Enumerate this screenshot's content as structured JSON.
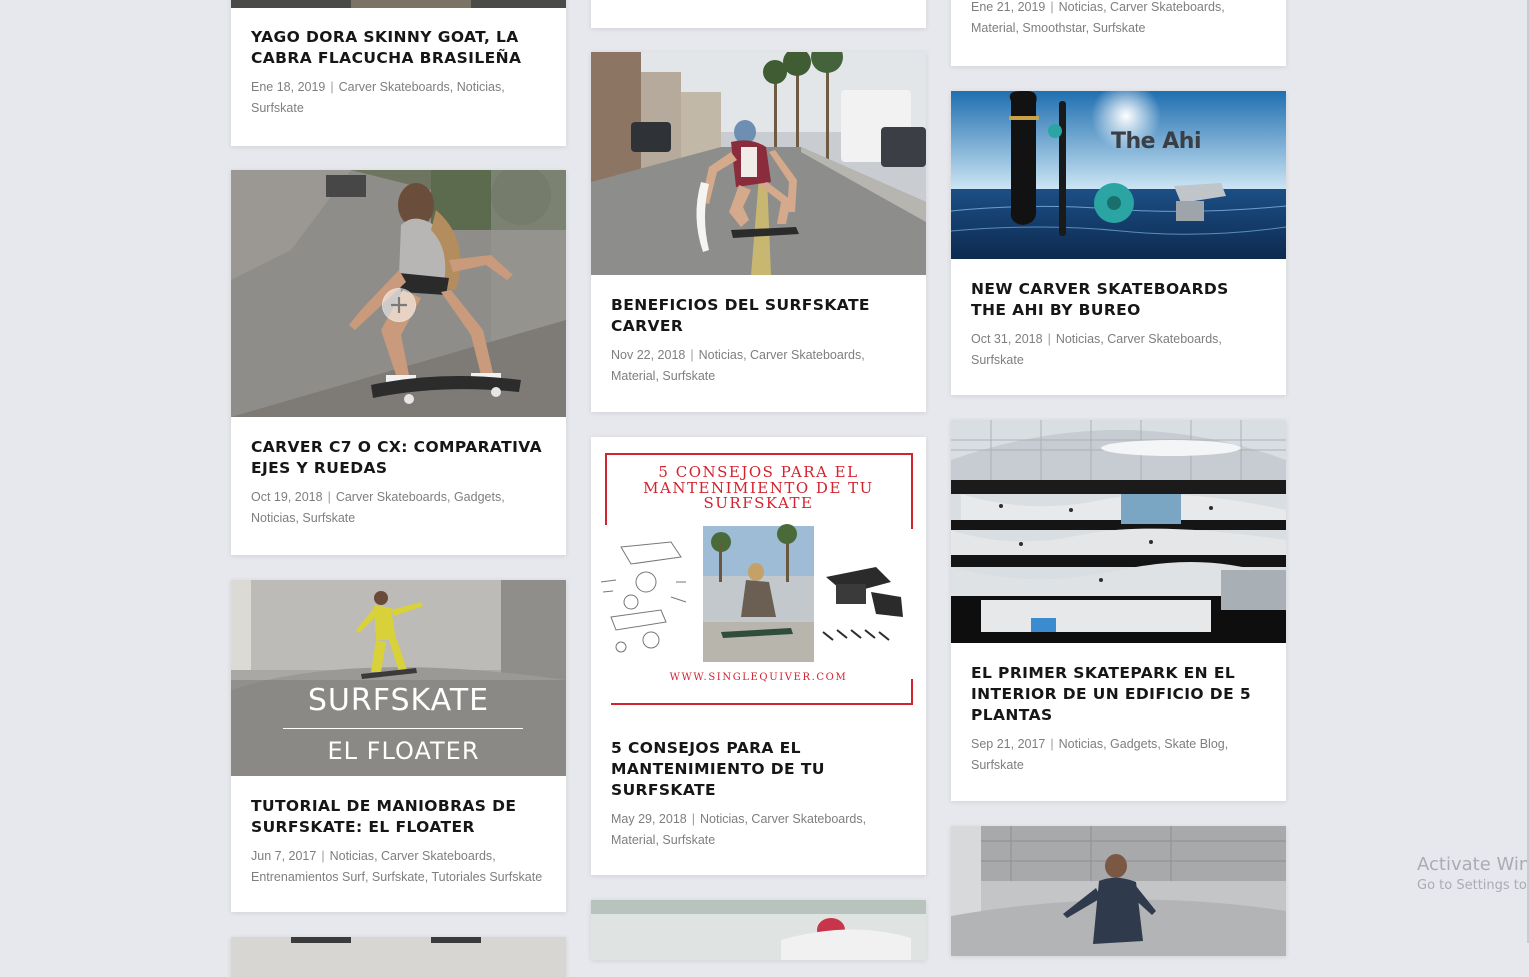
{
  "posts": {
    "p1": {
      "title": "YAGO DORA SKINNY GOAT, LA CABRA FLACUCHA BRASILEÑA",
      "date": "Ene 18, 2019",
      "cats": [
        "Carver Skateboards",
        "Noticias",
        "Surfskate"
      ]
    },
    "p2": {
      "title": "CARVER C7 O CX: COMPARATIVA EJES Y RUEDAS",
      "date": "Oct 19, 2018",
      "cats": [
        "Carver Skateboards",
        "Gadgets",
        "Noticias",
        "Surfskate"
      ]
    },
    "p3": {
      "title": "TUTORIAL DE MANIOBRAS DE SURFSKATE: EL FLOATER",
      "date": "Jun 7, 2017",
      "cats": [
        "Noticias",
        "Carver Skateboards",
        "Entrenamientos Surf",
        "Surfskate",
        "Tutoriales Surfskate"
      ],
      "image_line1": "SURFSKATE",
      "image_line2": "EL FLOATER"
    },
    "p4": {
      "title": "BENEFICIOS DEL SURFSKATE CARVER",
      "date": "Nov 22, 2018",
      "cats": [
        "Noticias",
        "Carver Skateboards",
        "Material",
        "Surfskate"
      ]
    },
    "p5": {
      "title": "5 CONSEJOS PARA EL MANTENIMIENTO DE TU SURFSKATE",
      "date": "May 29, 2018",
      "cats": [
        "Noticias",
        "Carver Skateboards",
        "Material",
        "Surfskate"
      ],
      "poster_line1": "5 CONSEJOS PARA EL",
      "poster_line2": "MANTENIMIENTO DE TU",
      "poster_line3": "SURFSKATE",
      "poster_url": "WWW.SINGLEQUIVER.COM"
    },
    "p6": {
      "date": "Ene 21, 2019",
      "cats": [
        "Noticias",
        "Carver Skateboards",
        "Material",
        "Smoothstar",
        "Surfskate"
      ]
    },
    "p7": {
      "title": "NEW CARVER SKATEBOARDS THE AHI BY BUREO",
      "date": "Oct 31, 2018",
      "cats": [
        "Noticias",
        "Carver Skateboards",
        "Surfskate"
      ],
      "image_text": "The Ahi"
    },
    "p8": {
      "title": "EL PRIMER SKATEPARK EN EL INTERIOR DE UN EDIFICIO DE 5 PLANTAS",
      "date": "Sep 21, 2017",
      "cats": [
        "Noticias",
        "Gadgets",
        "Skate Blog",
        "Surfskate"
      ]
    }
  },
  "watermark": {
    "line1": "Activate Win",
    "line2": "Go to Settings to"
  },
  "colors": {
    "background": "#e6e8ed",
    "card": "#ffffff",
    "title": "#161616",
    "meta": "#7e7e7e",
    "poster_red": "#d2232f"
  },
  "icons": {
    "hover_overlay": "plus-circle-icon"
  }
}
